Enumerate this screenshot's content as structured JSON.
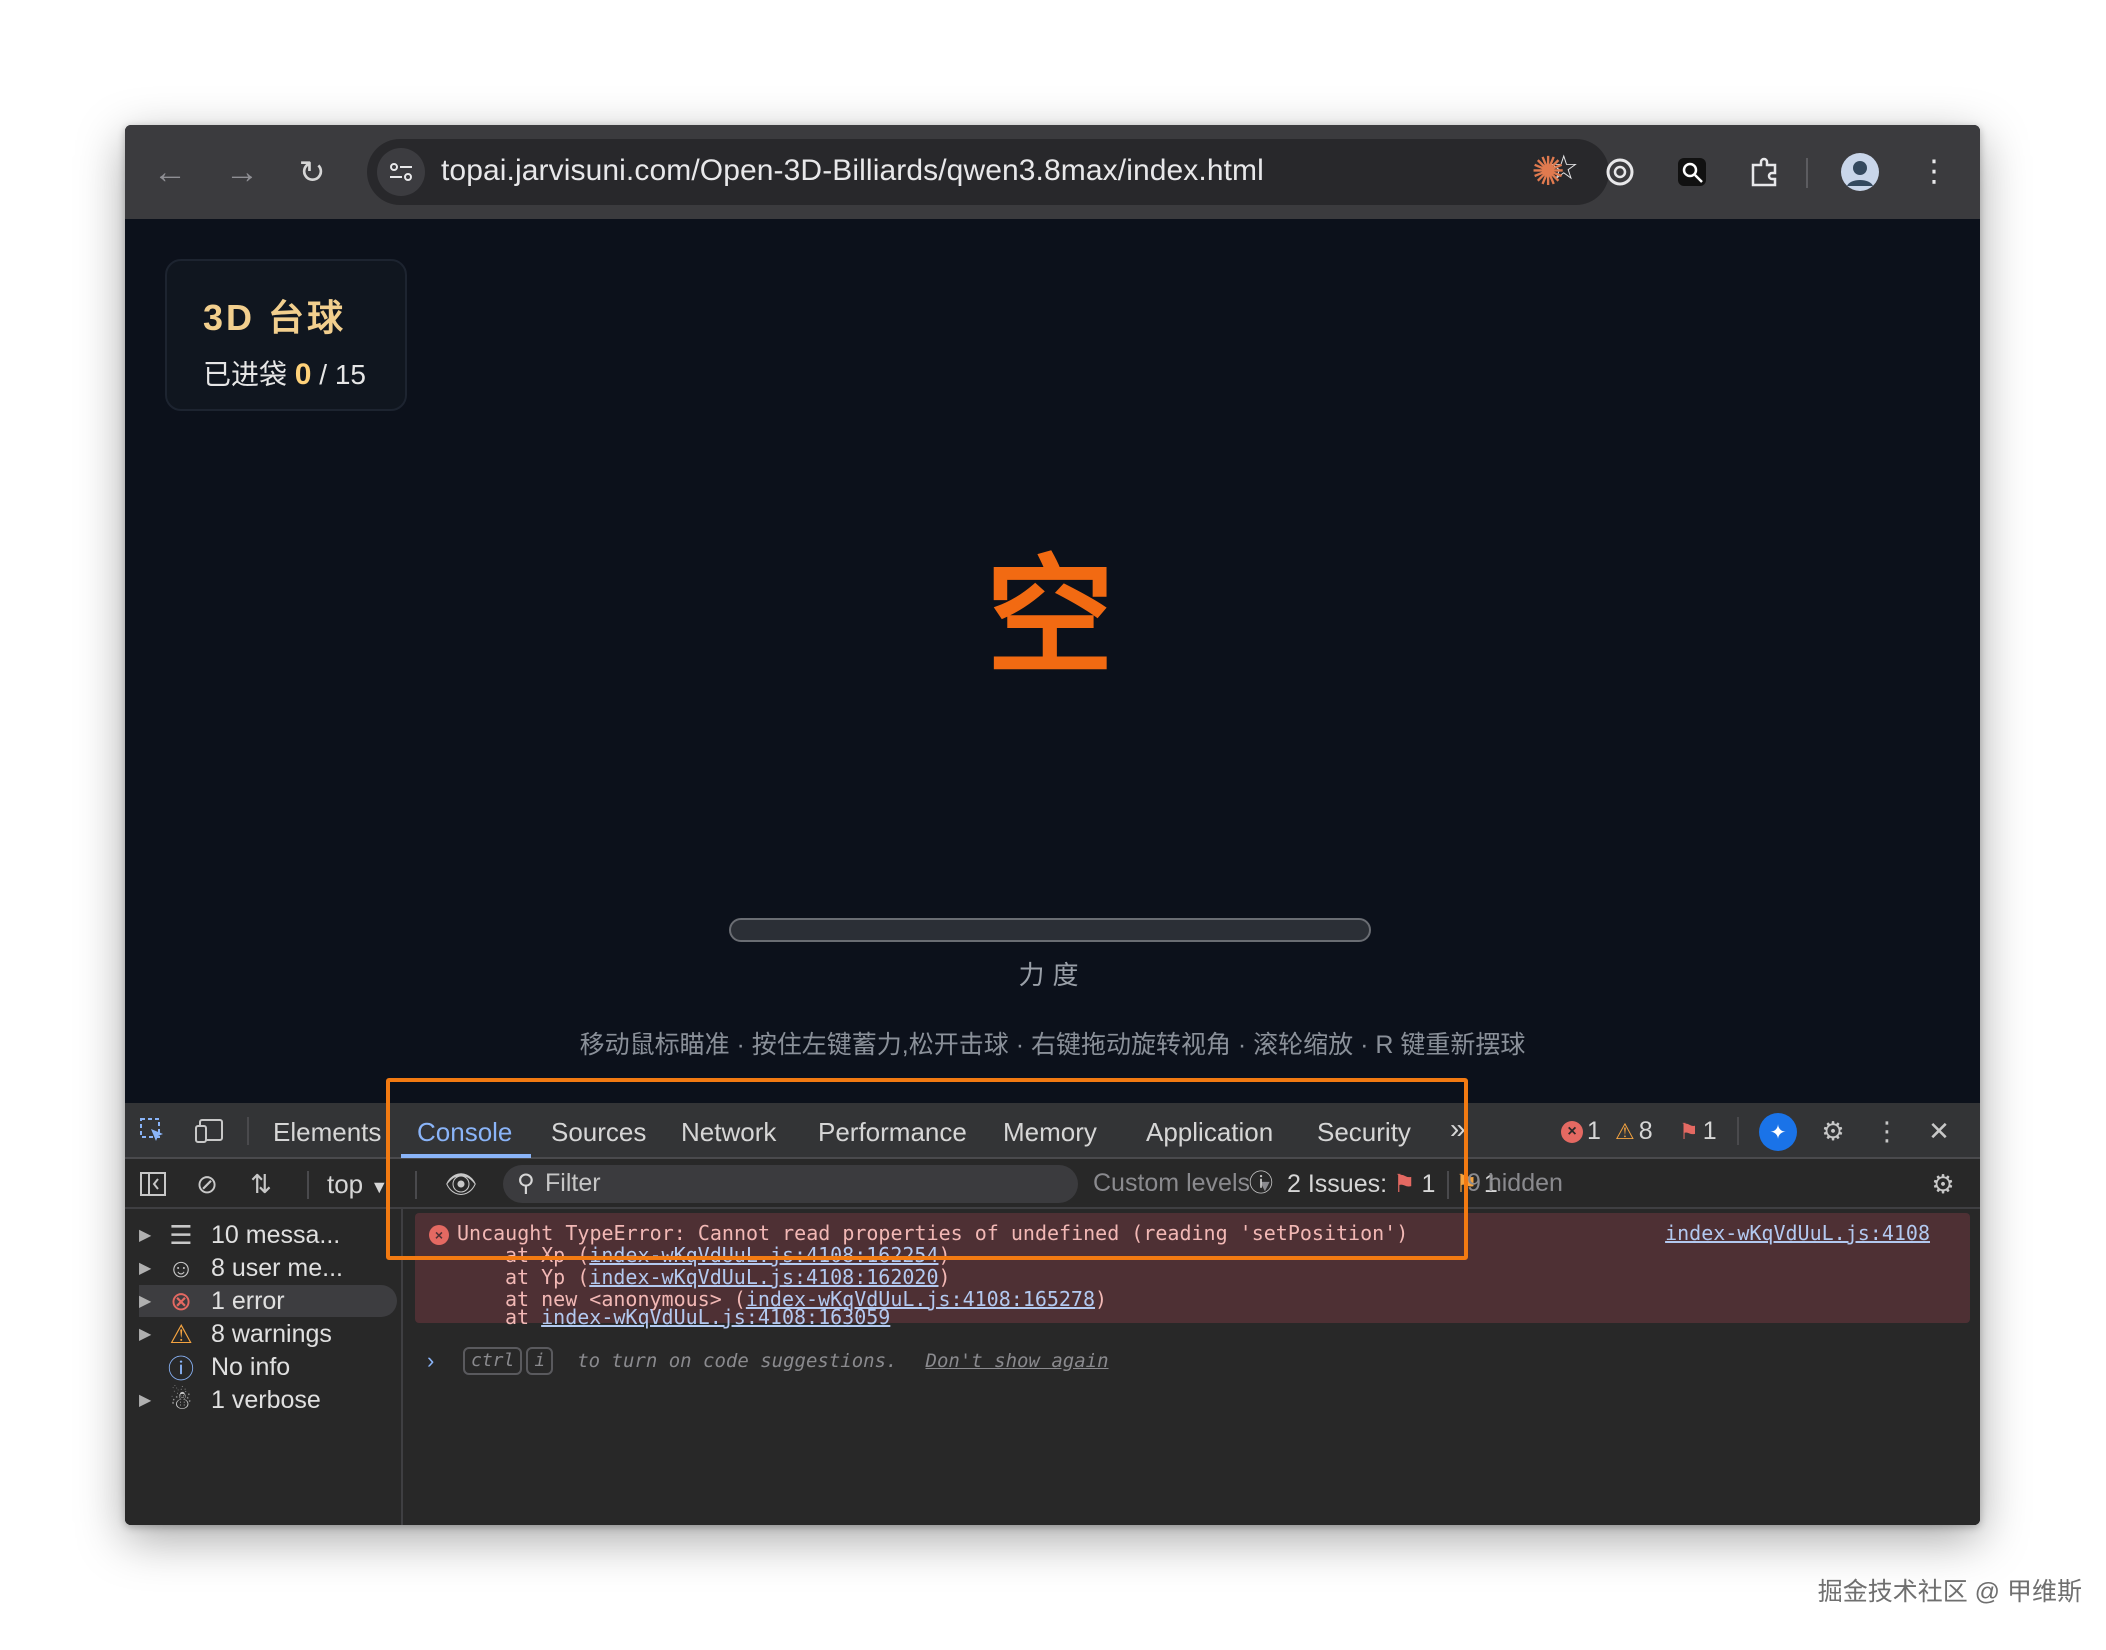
{
  "browser": {
    "url": "topai.jarvisuni.com/Open-3D-Billiards/qwen3.8max/index.html",
    "extensions": [
      "claude-icon",
      "openai-icon",
      "search-extension-icon",
      "puzzle-icon"
    ]
  },
  "game": {
    "title": "3D 台球",
    "score_label": "已进袋",
    "score_value": "0",
    "score_total": "/ 15",
    "center_char": "空",
    "power_label": "力度",
    "power_level": 0,
    "hint": "移动鼠标瞄准 · 按住左键蓄力,松开击球 · 右键拖动旋转视角 · 滚轮缩放 · R 键重新摆球",
    "accent_color": "#f26a12"
  },
  "devtools": {
    "tabs": [
      "Elements",
      "Console",
      "Sources",
      "Network",
      "Performance",
      "Memory",
      "Application",
      "Security"
    ],
    "active_tab": "Console",
    "more_tabs": "»",
    "counts": {
      "errors": "1",
      "warnings": "8",
      "issues": "1"
    },
    "toolbar": {
      "context": "top",
      "filter_placeholder": "Filter",
      "levels": "Custom levels",
      "issues_label": "2 Issues:",
      "issues_error": "1",
      "issues_warning": "1",
      "hidden": "9 hidden"
    },
    "sidebar": [
      {
        "label": "10 messa...",
        "icon": "list-icon"
      },
      {
        "label": "8 user me...",
        "icon": "user-icon"
      },
      {
        "label": "1 error",
        "icon": "error-icon"
      },
      {
        "label": "8 warnings",
        "icon": "warning-icon"
      },
      {
        "label": "No info",
        "icon": "info-icon"
      },
      {
        "label": "1 verbose",
        "icon": "bug-icon"
      }
    ],
    "console": {
      "error_message": "Uncaught TypeError: Cannot read properties of undefined (reading 'setPosition')",
      "source_link": "index-wKqVdUuL.js:4108",
      "stack": [
        {
          "prefix": "at Xp (",
          "link": "index-wKqVdUuL.js:4108:162254",
          "suffix": ")"
        },
        {
          "prefix": "at Yp (",
          "link": "index-wKqVdUuL.js:4108:162020",
          "suffix": ")"
        },
        {
          "prefix": "at new <anonymous> (",
          "link": "index-wKqVdUuL.js:4108:165278",
          "suffix": ")"
        },
        {
          "prefix": "at ",
          "link": "index-wKqVdUuL.js:4108:163059",
          "suffix": ""
        }
      ],
      "kbd_ctrl": "ctrl",
      "kbd_i": "i",
      "suggestion_hint": "to turn on code suggestions.",
      "dont_show": "Don't show again"
    }
  },
  "watermark": "掘金技术社区 @ 甲维斯"
}
